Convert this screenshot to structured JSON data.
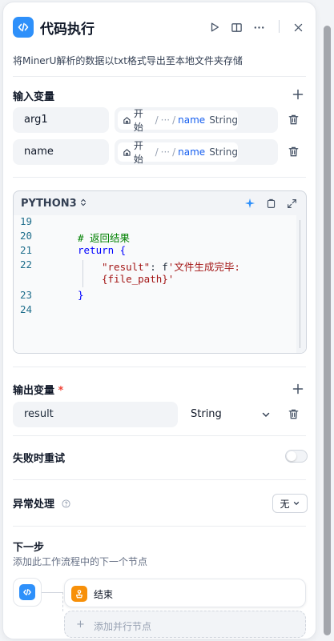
{
  "header": {
    "title": "代码执行",
    "description": "将MinerU解析的数据以txt格式导出至本地文件夹存储"
  },
  "input_section": {
    "title": "输入变量",
    "variables": [
      {
        "name": "arg1",
        "ref_start": "开始",
        "ref_ellipsis": "···",
        "ref_sep": "/",
        "ref_var": "name",
        "ref_type": "String"
      },
      {
        "name": "name",
        "ref_start": "开始",
        "ref_ellipsis": "···",
        "ref_sep": "/",
        "ref_var": "name",
        "ref_type": "String"
      }
    ]
  },
  "code_editor": {
    "language": "PYTHON3",
    "lines": [
      {
        "num": "19",
        "text": ""
      },
      {
        "num": "20",
        "text": "# 返回结果"
      },
      {
        "num": "21",
        "text": "return {"
      },
      {
        "num": "22",
        "key": "\"result\"",
        "colon": ": f",
        "str": "'文件生成完毕:"
      },
      {
        "cont": "{file_path}'"
      },
      {
        "num": "23",
        "text": "}"
      },
      {
        "num": "24",
        "text": ""
      }
    ]
  },
  "output_section": {
    "title": "输出变量",
    "required_mark": "*",
    "variable": {
      "name": "result",
      "type": "String"
    }
  },
  "retry": {
    "label": "失败时重试",
    "enabled": false
  },
  "error_handling": {
    "label": "异常处理",
    "value": "无"
  },
  "next_step": {
    "title": "下一步",
    "description": "添加此工作流程中的下一个节点",
    "next_node_label": "结束",
    "add_parallel_label": "添加并行节点",
    "add_parallel_plus": "+"
  },
  "colors": {
    "accent": "#2e90fa",
    "end_node": "#f79009",
    "required": "#f04438"
  }
}
